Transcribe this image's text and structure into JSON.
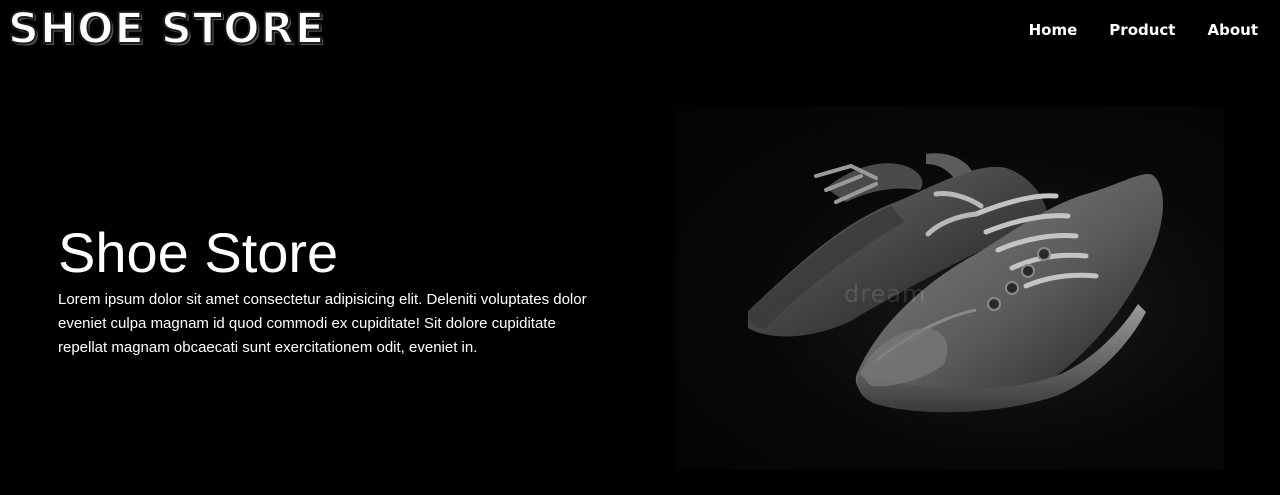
{
  "header": {
    "logo": "SHOE STORE",
    "nav": [
      {
        "label": "Home"
      },
      {
        "label": "Product"
      },
      {
        "label": "About"
      }
    ]
  },
  "hero": {
    "title": "Shoe Store",
    "description": "Lorem ipsum dolor sit amet consectetur adipisicing elit. Deleniti voluptates dolor eveniet culpa magnam id quod commodi ex cupiditate! Sit dolore cupiditate repellat magnam obcaecati sunt exercitationem odit, eveniet in.",
    "image": {
      "subject": "pair of worn grey canvas sneakers",
      "watermark": "dream"
    }
  },
  "colors": {
    "background": "#010101",
    "header": "#000000",
    "text": "#ffffff"
  }
}
